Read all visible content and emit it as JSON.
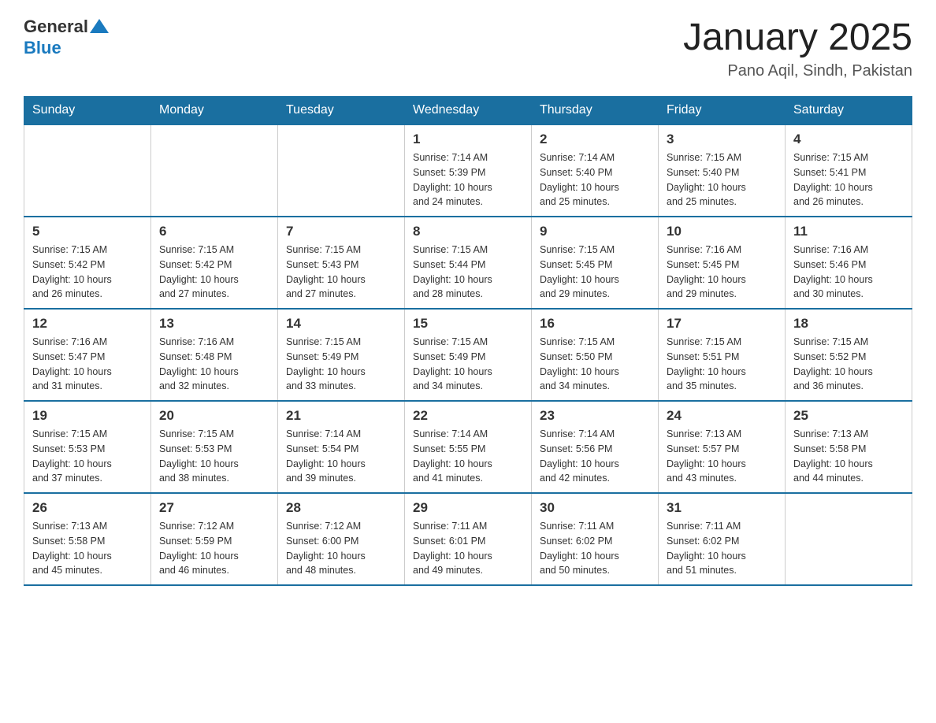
{
  "header": {
    "month_title": "January 2025",
    "location": "Pano Aqil, Sindh, Pakistan",
    "logo_general": "General",
    "logo_blue": "Blue"
  },
  "days_of_week": [
    "Sunday",
    "Monday",
    "Tuesday",
    "Wednesday",
    "Thursday",
    "Friday",
    "Saturday"
  ],
  "weeks": [
    [
      {
        "day": "",
        "info": ""
      },
      {
        "day": "",
        "info": ""
      },
      {
        "day": "",
        "info": ""
      },
      {
        "day": "1",
        "info": "Sunrise: 7:14 AM\nSunset: 5:39 PM\nDaylight: 10 hours\nand 24 minutes."
      },
      {
        "day": "2",
        "info": "Sunrise: 7:14 AM\nSunset: 5:40 PM\nDaylight: 10 hours\nand 25 minutes."
      },
      {
        "day": "3",
        "info": "Sunrise: 7:15 AM\nSunset: 5:40 PM\nDaylight: 10 hours\nand 25 minutes."
      },
      {
        "day": "4",
        "info": "Sunrise: 7:15 AM\nSunset: 5:41 PM\nDaylight: 10 hours\nand 26 minutes."
      }
    ],
    [
      {
        "day": "5",
        "info": "Sunrise: 7:15 AM\nSunset: 5:42 PM\nDaylight: 10 hours\nand 26 minutes."
      },
      {
        "day": "6",
        "info": "Sunrise: 7:15 AM\nSunset: 5:42 PM\nDaylight: 10 hours\nand 27 minutes."
      },
      {
        "day": "7",
        "info": "Sunrise: 7:15 AM\nSunset: 5:43 PM\nDaylight: 10 hours\nand 27 minutes."
      },
      {
        "day": "8",
        "info": "Sunrise: 7:15 AM\nSunset: 5:44 PM\nDaylight: 10 hours\nand 28 minutes."
      },
      {
        "day": "9",
        "info": "Sunrise: 7:15 AM\nSunset: 5:45 PM\nDaylight: 10 hours\nand 29 minutes."
      },
      {
        "day": "10",
        "info": "Sunrise: 7:16 AM\nSunset: 5:45 PM\nDaylight: 10 hours\nand 29 minutes."
      },
      {
        "day": "11",
        "info": "Sunrise: 7:16 AM\nSunset: 5:46 PM\nDaylight: 10 hours\nand 30 minutes."
      }
    ],
    [
      {
        "day": "12",
        "info": "Sunrise: 7:16 AM\nSunset: 5:47 PM\nDaylight: 10 hours\nand 31 minutes."
      },
      {
        "day": "13",
        "info": "Sunrise: 7:16 AM\nSunset: 5:48 PM\nDaylight: 10 hours\nand 32 minutes."
      },
      {
        "day": "14",
        "info": "Sunrise: 7:15 AM\nSunset: 5:49 PM\nDaylight: 10 hours\nand 33 minutes."
      },
      {
        "day": "15",
        "info": "Sunrise: 7:15 AM\nSunset: 5:49 PM\nDaylight: 10 hours\nand 34 minutes."
      },
      {
        "day": "16",
        "info": "Sunrise: 7:15 AM\nSunset: 5:50 PM\nDaylight: 10 hours\nand 34 minutes."
      },
      {
        "day": "17",
        "info": "Sunrise: 7:15 AM\nSunset: 5:51 PM\nDaylight: 10 hours\nand 35 minutes."
      },
      {
        "day": "18",
        "info": "Sunrise: 7:15 AM\nSunset: 5:52 PM\nDaylight: 10 hours\nand 36 minutes."
      }
    ],
    [
      {
        "day": "19",
        "info": "Sunrise: 7:15 AM\nSunset: 5:53 PM\nDaylight: 10 hours\nand 37 minutes."
      },
      {
        "day": "20",
        "info": "Sunrise: 7:15 AM\nSunset: 5:53 PM\nDaylight: 10 hours\nand 38 minutes."
      },
      {
        "day": "21",
        "info": "Sunrise: 7:14 AM\nSunset: 5:54 PM\nDaylight: 10 hours\nand 39 minutes."
      },
      {
        "day": "22",
        "info": "Sunrise: 7:14 AM\nSunset: 5:55 PM\nDaylight: 10 hours\nand 41 minutes."
      },
      {
        "day": "23",
        "info": "Sunrise: 7:14 AM\nSunset: 5:56 PM\nDaylight: 10 hours\nand 42 minutes."
      },
      {
        "day": "24",
        "info": "Sunrise: 7:13 AM\nSunset: 5:57 PM\nDaylight: 10 hours\nand 43 minutes."
      },
      {
        "day": "25",
        "info": "Sunrise: 7:13 AM\nSunset: 5:58 PM\nDaylight: 10 hours\nand 44 minutes."
      }
    ],
    [
      {
        "day": "26",
        "info": "Sunrise: 7:13 AM\nSunset: 5:58 PM\nDaylight: 10 hours\nand 45 minutes."
      },
      {
        "day": "27",
        "info": "Sunrise: 7:12 AM\nSunset: 5:59 PM\nDaylight: 10 hours\nand 46 minutes."
      },
      {
        "day": "28",
        "info": "Sunrise: 7:12 AM\nSunset: 6:00 PM\nDaylight: 10 hours\nand 48 minutes."
      },
      {
        "day": "29",
        "info": "Sunrise: 7:11 AM\nSunset: 6:01 PM\nDaylight: 10 hours\nand 49 minutes."
      },
      {
        "day": "30",
        "info": "Sunrise: 7:11 AM\nSunset: 6:02 PM\nDaylight: 10 hours\nand 50 minutes."
      },
      {
        "day": "31",
        "info": "Sunrise: 7:11 AM\nSunset: 6:02 PM\nDaylight: 10 hours\nand 51 minutes."
      },
      {
        "day": "",
        "info": ""
      }
    ]
  ]
}
